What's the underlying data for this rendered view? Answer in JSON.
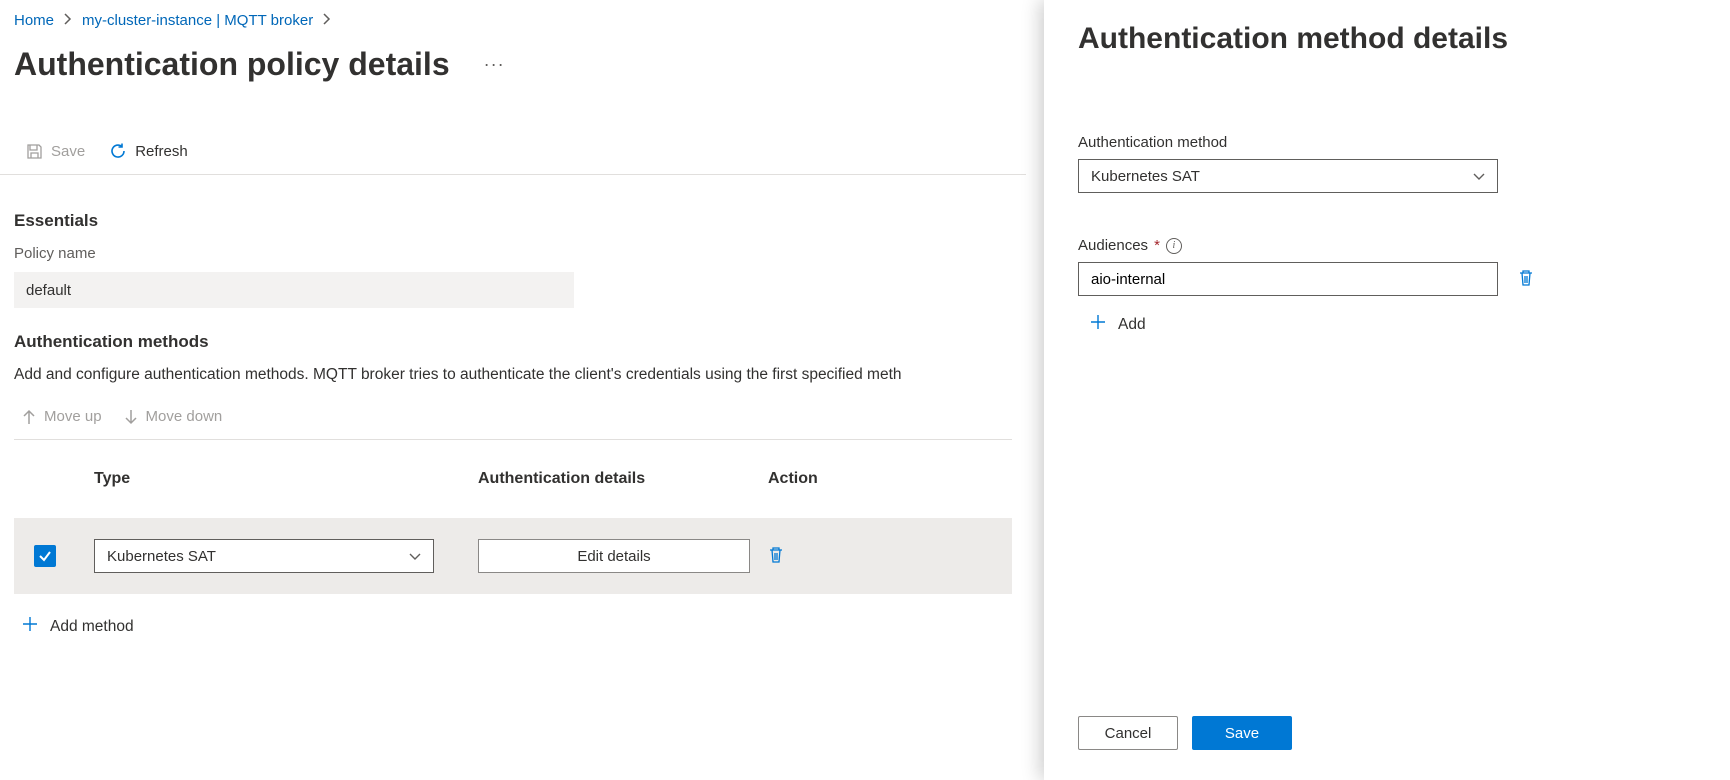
{
  "breadcrumb": {
    "home": "Home",
    "instance": "my-cluster-instance | MQTT broker"
  },
  "page": {
    "title": "Authentication policy details"
  },
  "toolbar": {
    "save_label": "Save",
    "refresh_label": "Refresh"
  },
  "essentials": {
    "heading": "Essentials",
    "policy_name_label": "Policy name",
    "policy_name_value": "default"
  },
  "auth_methods": {
    "heading": "Authentication methods",
    "description": "Add and configure authentication methods. MQTT broker tries to authenticate the client's credentials using the first specified meth",
    "move_up": "Move up",
    "move_down": "Move down",
    "columns": {
      "type": "Type",
      "details": "Authentication details",
      "action": "Action"
    },
    "rows": [
      {
        "type": "Kubernetes SAT",
        "edit": "Edit details"
      }
    ],
    "add_method": "Add method"
  },
  "panel": {
    "title": "Authentication method details",
    "method_label": "Authentication method",
    "method_value": "Kubernetes SAT",
    "audiences_label": "Audiences",
    "audiences_value": "aio-internal",
    "add_label": "Add",
    "cancel": "Cancel",
    "save": "Save"
  }
}
